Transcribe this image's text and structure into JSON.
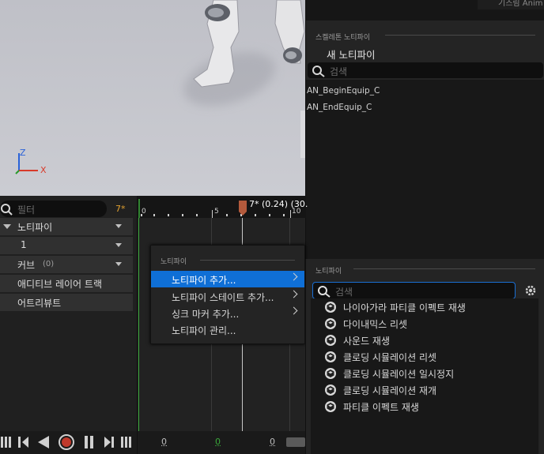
{
  "viewport": {
    "axis_z": "Z",
    "axis_x": "X"
  },
  "top_tab": {
    "label": "기즈림 Anim"
  },
  "skeleton_notifies": {
    "section_label": "스켈레톤 노티파이",
    "new_notify": "새 노티파이",
    "search_placeholder": "검색",
    "items": [
      "AN_BeginEquip_C",
      "AN_EndEquip_C"
    ]
  },
  "track_panel": {
    "filter_placeholder": "필터",
    "frame_count": "7*",
    "rows": [
      {
        "label": "노티파이",
        "has_arrow": true
      },
      {
        "label": "1",
        "has_arrow": true
      },
      {
        "label": "커브",
        "count": "(0)",
        "has_arrow": true
      },
      {
        "label": "애디티브 레이어 트랙",
        "has_arrow": false
      },
      {
        "label": "어트리뷰트",
        "has_arrow": false
      }
    ]
  },
  "timeline": {
    "playhead_label": "7* (0.24) (30.",
    "ticks": [
      "0",
      "5",
      "10"
    ],
    "bottom_values": [
      "0",
      "0",
      "0"
    ]
  },
  "context_menu": {
    "section_label": "노티파이",
    "items": [
      {
        "label": "노티파이 추가...",
        "has_submenu": true,
        "selected": true
      },
      {
        "label": "노티파이 스테이트 추가...",
        "has_submenu": true,
        "selected": false
      },
      {
        "label": "싱크 마커 추가...",
        "has_submenu": true,
        "selected": false
      },
      {
        "label": "노티파이 관리...",
        "has_submenu": false,
        "selected": false
      }
    ]
  },
  "notify_class_picker": {
    "section_label": "노티파이",
    "search_placeholder": "검색",
    "settings_icon": "gear-icon",
    "items": [
      "나이아가라 파티클 이펙트 재생",
      "다이내믹스 리셋",
      "사운드 재생",
      "클로딩 시뮬레이션 리셋",
      "클로딩 시뮬레이션 일시정지",
      "클로딩 시뮬레이션 재개",
      "파티클 이펙트 재생"
    ]
  },
  "colors": {
    "accent_blue": "#0f6fd6",
    "record_red": "#c0392b",
    "frame_orange": "#e0a030",
    "playhead": "#b45a3c",
    "green_marker": "#3aa83a"
  }
}
